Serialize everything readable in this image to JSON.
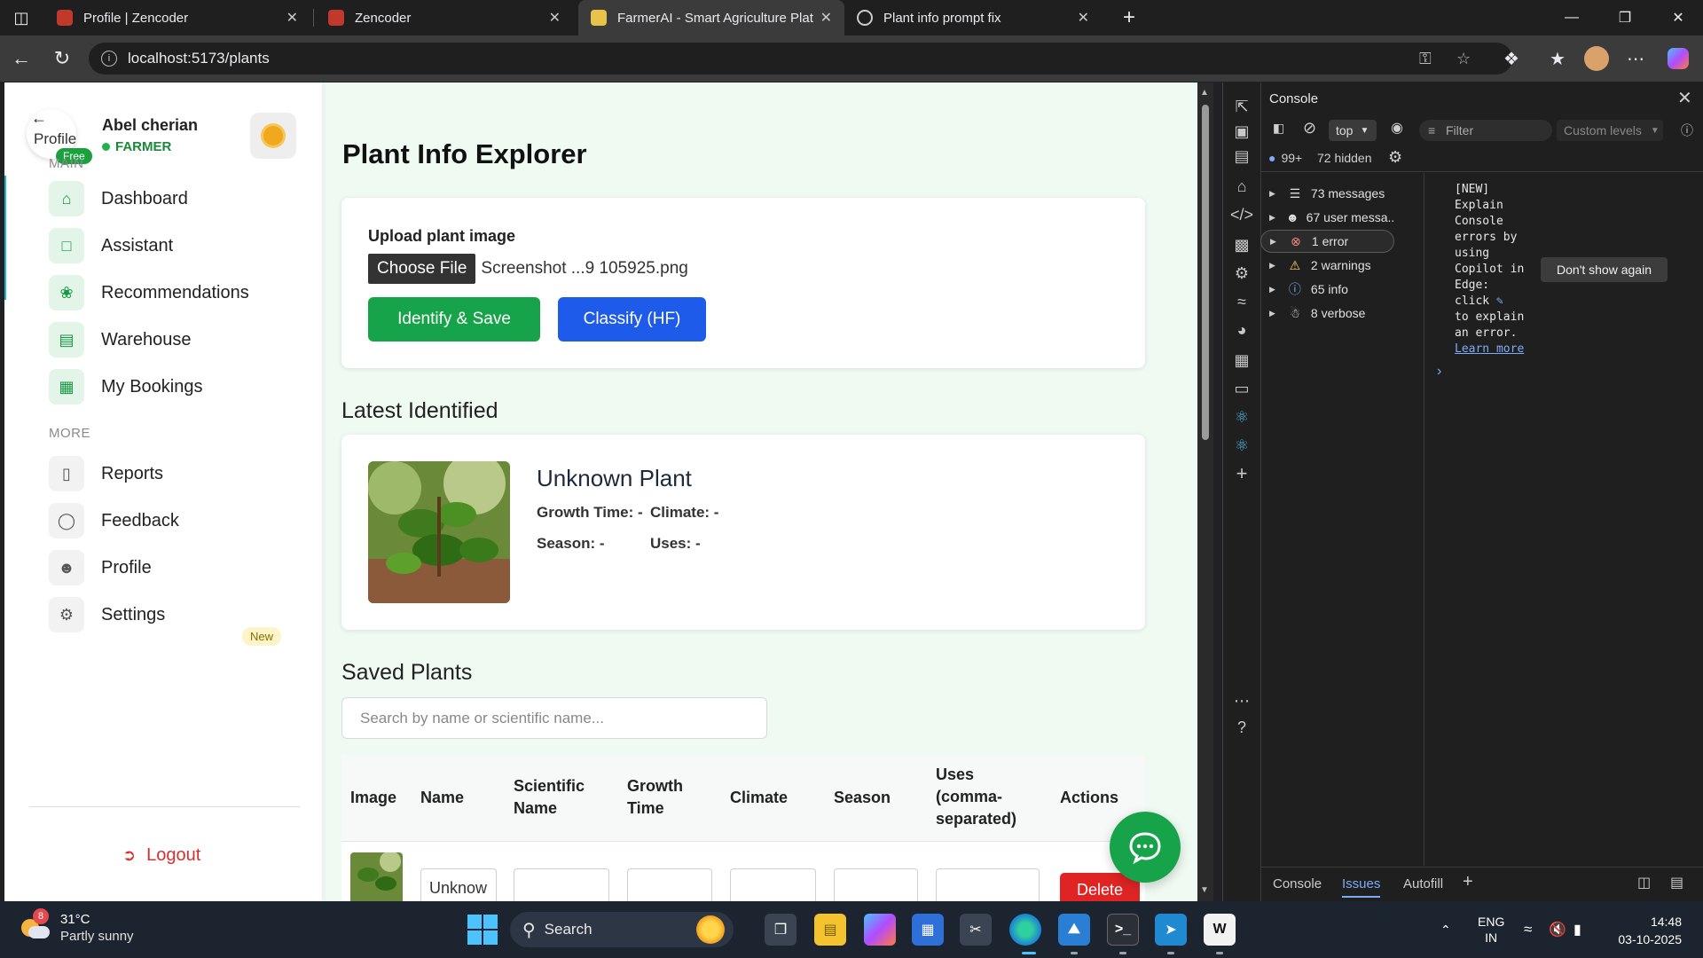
{
  "browser": {
    "tabs": [
      {
        "label": "Profile | Zencoder",
        "favicon_color": "#c0392b"
      },
      {
        "label": "Zencoder",
        "favicon_color": "#c0392b"
      },
      {
        "label": "FarmerAI - Smart Agriculture Platf",
        "favicon_color": "#e7c34a"
      },
      {
        "label": "Plant info prompt fix",
        "favicon_color": "#cccccc"
      }
    ],
    "url": "localhost:5173/plants"
  },
  "sidebar": {
    "avatar_text": "Profile",
    "free_badge": "Free",
    "user_name": "Abel cherian",
    "user_role": "FARMER",
    "main_section": "MAIN",
    "main_items": [
      {
        "label": "Dashboard",
        "icon": "home-icon"
      },
      {
        "label": "Assistant",
        "icon": "chat-icon"
      },
      {
        "label": "Recommendations",
        "icon": "sprout-icon"
      },
      {
        "label": "Warehouse",
        "icon": "warehouse-icon"
      },
      {
        "label": "My Bookings",
        "icon": "calendar-icon"
      }
    ],
    "more_section": "MORE",
    "more_items": [
      {
        "label": "Reports",
        "icon": "bar-chart-icon"
      },
      {
        "label": "Feedback",
        "icon": "message-icon",
        "badge": "New"
      },
      {
        "label": "Profile",
        "icon": "user-icon"
      },
      {
        "label": "Settings",
        "icon": "gear-icon"
      }
    ],
    "logout_label": "Logout"
  },
  "main": {
    "title": "Plant Info Explorer",
    "upload": {
      "label": "Upload plant image",
      "choose_file": "Choose File",
      "file_name": "Screenshot ...9 105925.png",
      "identify_button": "Identify & Save",
      "classify_button": "Classify (HF)"
    },
    "latest": {
      "section_title": "Latest Identified",
      "plant_name": "Unknown Plant",
      "growth_time": "Growth Time: -",
      "climate": "Climate: -",
      "season": "Season: -",
      "uses": "Uses: -"
    },
    "saved": {
      "section_title": "Saved Plants",
      "search_placeholder": "Search by name or scientific name...",
      "columns": [
        "Image",
        "Name",
        "Scientific Name",
        "Growth Time",
        "Climate",
        "Season",
        "Uses (comma-separated)",
        "Actions"
      ],
      "rows": [
        {
          "name": "Unknow",
          "scientific_name": "",
          "growth_time": "",
          "climate": "",
          "season": "",
          "uses": "",
          "action": "Delete"
        }
      ]
    }
  },
  "devtools": {
    "title": "Console",
    "context": "top",
    "filter_placeholder": "Filter",
    "levels": "Custom levels",
    "issues_count": "99+",
    "hidden": "72 hidden",
    "messages": [
      {
        "label": "73 messages",
        "icon": "list-icon"
      },
      {
        "label": "67 user messa...",
        "icon": "user-circle-icon"
      },
      {
        "label": "1 error",
        "icon": "error-icon"
      },
      {
        "label": "2 warnings",
        "icon": "warning-icon"
      },
      {
        "label": "65 info",
        "icon": "info-icon"
      },
      {
        "label": "8 verbose",
        "icon": "bug-icon"
      }
    ],
    "console_lines": [
      "[NEW]",
      "Explain",
      "Console",
      "errors by",
      "using",
      "Copilot in",
      "Edge:",
      "click",
      "to explain",
      "an error."
    ],
    "learn_more": "Learn more",
    "tooltip": "Don't show again",
    "bottom_tabs": [
      "Console",
      "Issues",
      "Autofill"
    ]
  },
  "taskbar": {
    "weather_temp": "31°C",
    "weather_desc": "Partly sunny",
    "weather_badge": "8",
    "search_label": "Search",
    "lang_line1": "ENG",
    "lang_line2": "IN",
    "time": "14:48",
    "date": "03-10-2025"
  }
}
